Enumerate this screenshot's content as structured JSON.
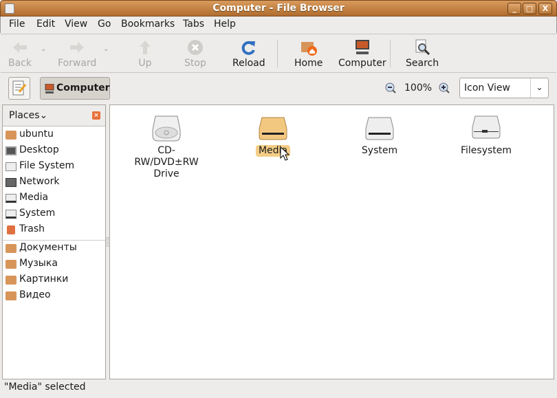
{
  "window": {
    "title": "Computer - File Browser",
    "minimize": "_",
    "maximize": "□",
    "close": "X"
  },
  "menu": [
    "File",
    "Edit",
    "View",
    "Go",
    "Bookmarks",
    "Tabs",
    "Help"
  ],
  "toolbar": {
    "back": "Back",
    "forward": "Forward",
    "up": "Up",
    "stop": "Stop",
    "reload": "Reload",
    "home": "Home",
    "computer": "Computer",
    "search": "Search"
  },
  "location": {
    "current": "Computer",
    "zoom": "100%",
    "view_mode": "Icon View"
  },
  "sidebar": {
    "title": "Places",
    "items": [
      "ubuntu",
      "Desktop",
      "File System",
      "Network",
      "Media",
      "System",
      "Trash"
    ],
    "bookmarks": [
      "Документы",
      "Музыка",
      "Картинки",
      "Видео"
    ]
  },
  "files": [
    {
      "name": "CD-RW/DVD±RW Drive"
    },
    {
      "name": "Media",
      "selected": true
    },
    {
      "name": "System"
    },
    {
      "name": "Filesystem"
    }
  ],
  "status": "\"Media\" selected",
  "colors": {
    "titlebar": "#c07d3e",
    "selection": "#f4cd86"
  }
}
